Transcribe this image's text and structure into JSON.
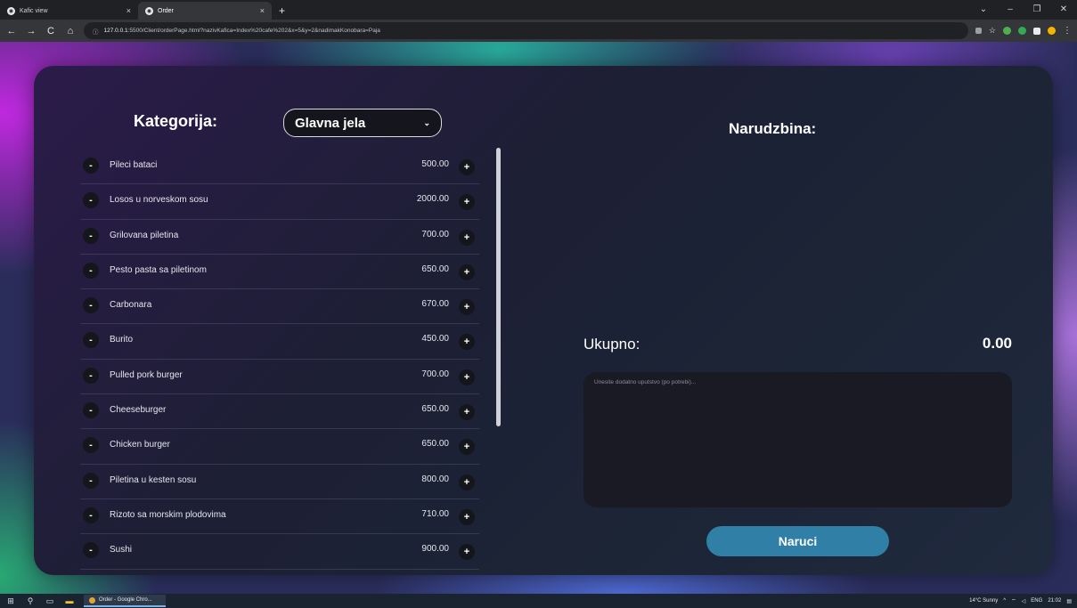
{
  "browser": {
    "tabs": [
      {
        "title": "Kafic view",
        "active": false
      },
      {
        "title": "Order",
        "active": true
      }
    ],
    "url_prefix": "ⓘ",
    "url_host": "127.0.0.1",
    "url_rest": ":5500/Client/orderPage.html?nazivKafica=Index%20cafe%202&x=5&y=2&nadimakKonobara=Paja"
  },
  "menu": {
    "category_label": "Kategorija:",
    "selected_category": "Glavna jela",
    "items": [
      {
        "name": "Pileci bataci",
        "price": "500.00"
      },
      {
        "name": "Losos u norveskom sosu",
        "price": "2000.00"
      },
      {
        "name": "Grilovana piletina",
        "price": "700.00"
      },
      {
        "name": "Pesto pasta sa piletinom",
        "price": "650.00"
      },
      {
        "name": "Carbonara",
        "price": "670.00"
      },
      {
        "name": "Burito",
        "price": "450.00"
      },
      {
        "name": "Pulled pork burger",
        "price": "700.00"
      },
      {
        "name": "Cheeseburger",
        "price": "650.00"
      },
      {
        "name": "Chicken burger",
        "price": "650.00"
      },
      {
        "name": "Piletina u kesten sosu",
        "price": "800.00"
      },
      {
        "name": "Rizoto sa morskim plodovima",
        "price": "710.00"
      },
      {
        "name": "Sushi",
        "price": "900.00"
      }
    ],
    "minus_symbol": "-",
    "plus_symbol": "+"
  },
  "order": {
    "title": "Narudzbina:",
    "total_label": "Ukupno:",
    "total_value": "0.00",
    "notes_placeholder": "Unesite dodatno uputstvo (po potrebi)...",
    "submit_label": "Naruci"
  },
  "taskbar": {
    "app_label": "Order - Google Chro...",
    "weather": "14°C  Sunny",
    "lang": "ENG",
    "time": "21:02"
  },
  "colors": {
    "accent_button": "#2f7fa6",
    "card_bg": "#1d1f34"
  }
}
